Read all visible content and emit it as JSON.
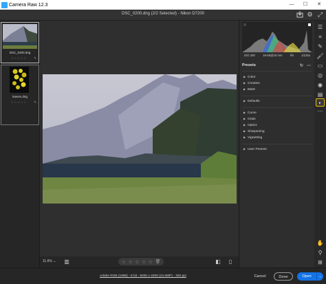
{
  "window": {
    "title": "Camera Raw 12.3",
    "controls": {
      "minimize": "—",
      "maximize": "☐",
      "close": "✕"
    }
  },
  "header": {
    "file_title": "DSC_0200.dng (2/2 Selected)  -  Nikon D7200"
  },
  "filmstrip": {
    "items": [
      {
        "name": "DSC_0200.dng",
        "stars": "☆☆☆☆☆",
        "badge": "✎"
      },
      {
        "name": "leaves.dng",
        "stars": "☆☆☆☆☆",
        "badge": "✎"
      }
    ]
  },
  "canvas": {
    "zoom": "11.6%",
    "zoom_arrow": "⌄",
    "rating": [
      "☆",
      "☆",
      "☆",
      "☆",
      "☆",
      "🗑"
    ]
  },
  "panel": {
    "camera_info": [
      "ISO 200",
      "18-55@18 mm",
      "f/8",
      "1/125s"
    ],
    "presets_title": "Presets",
    "presets": [
      {
        "label": "Color",
        "group": 1
      },
      {
        "label": "Creative",
        "group": 1
      },
      {
        "label": "B&W",
        "group": 1
      },
      {
        "label": "Defaults",
        "group": 2
      },
      {
        "label": "Curve",
        "group": 3
      },
      {
        "label": "Grain",
        "group": 3
      },
      {
        "label": "Optics",
        "group": 3
      },
      {
        "label": "Sharpening",
        "group": 3
      },
      {
        "label": "Vignetting",
        "group": 3
      },
      {
        "label": "User Presets",
        "group": 4
      }
    ]
  },
  "footer": {
    "image_info": "Adobe RGB (1998) - 8 bit - 6000 x 4000 (24.0MP) - 300 ppi",
    "cancel": "Cancel",
    "done": "Done",
    "open": "Open"
  },
  "colors": {
    "accent": "#1473e6",
    "active_tool_border": "#f0c000",
    "background": "#2b2b2b"
  }
}
